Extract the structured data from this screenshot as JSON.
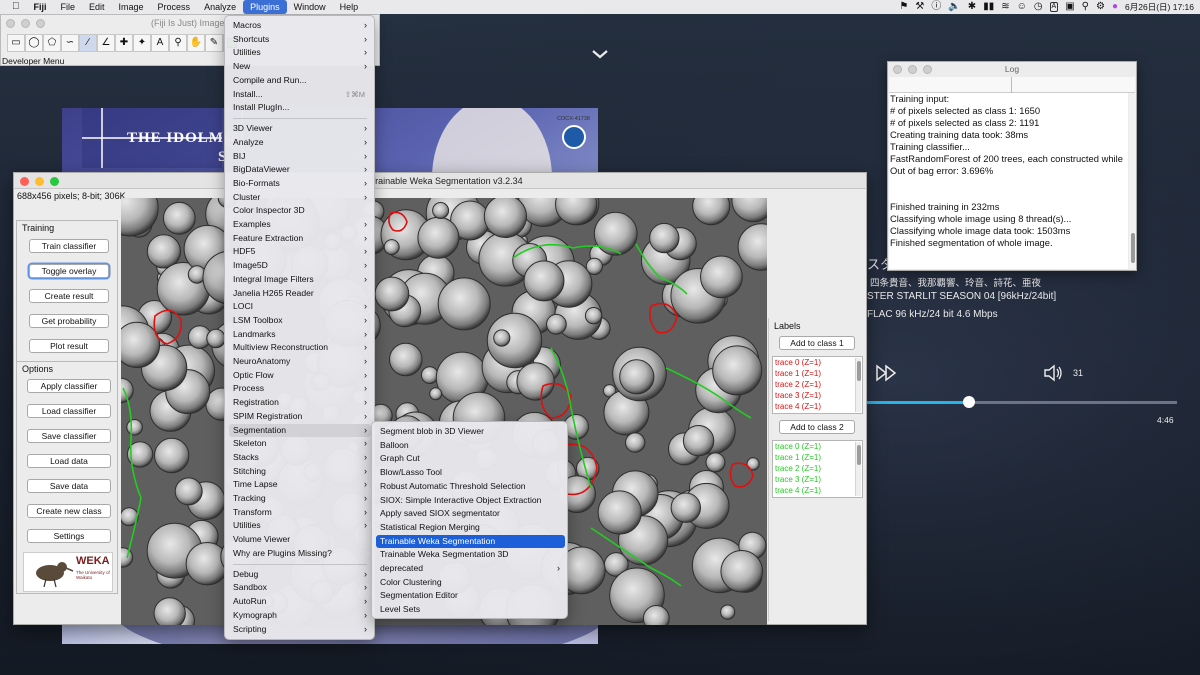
{
  "menubar": {
    "app_name": "Fiji",
    "items": [
      "File",
      "Edit",
      "Image",
      "Process",
      "Analyze",
      "Plugins",
      "Window",
      "Help"
    ],
    "active_item": "Plugins",
    "datetime": "6月26日(日)  17:16"
  },
  "fiji_window": {
    "title": "(Fiji Is Just) ImageJ",
    "tools": [
      "rectangle",
      "oval",
      "polygon",
      "freehand",
      "straight-line",
      "angle",
      "point",
      "wand",
      "text",
      "magnifier",
      "hand",
      "eyedropper",
      "color"
    ],
    "developer_menu": "Developer Menu"
  },
  "album": {
    "title_text": "THE IDOLM@",
    "subtitle_text": "S",
    "code": "COCX-41738"
  },
  "weka_window": {
    "title": "Trainable Weka Segmentation v3.2.34",
    "image_info": "688x456 pixels; 8-bit; 306K",
    "training": {
      "label": "Training",
      "buttons": [
        "Train classifier",
        "Toggle overlay",
        "Create result",
        "Get probability",
        "Plot result"
      ]
    },
    "options": {
      "label": "Options",
      "buttons": [
        "Apply classifier",
        "Load classifier",
        "Save classifier",
        "Load data",
        "Save data",
        "Create new class",
        "Settings"
      ]
    },
    "logo": {
      "title": "WEKA",
      "subtitle": "The University of Waikato"
    },
    "labels": {
      "title": "Labels",
      "class1_button": "Add to class 1",
      "class2_button": "Add to class 2",
      "class1_traces": [
        "trace 0 (Z=1)",
        "trace 1 (Z=1)",
        "trace 2 (Z=1)",
        "trace 3 (Z=1)",
        "trace 4 (Z=1)"
      ],
      "class2_traces": [
        "trace 0 (Z=1)",
        "trace 1 (Z=1)",
        "trace 2 (Z=1)",
        "trace 3 (Z=1)",
        "trace 4 (Z=1)"
      ],
      "class1_color": "#e01010",
      "class2_color": "#22cc22"
    }
  },
  "log_window": {
    "title": "Log",
    "lines": [
      "Training input:",
      "# of pixels selected as class 1: 1650",
      "# of pixels selected as class 2: 1191",
      "Creating training data took: 38ms",
      "Training classifier...",
      "FastRandomForest of 200 trees, each constructed while",
      "Out of bag error: 3.696%",
      "",
      "",
      "Finished training in 232ms",
      "Classifying whole image using 8 thread(s)...",
      "Classifying whole image data took: 1503ms",
      "Finished segmentation of whole image."
    ]
  },
  "music_player": {
    "title_fragment": "スタ",
    "artists": "四条貴音、我那覇響、玲音、詩花、亜夜",
    "album": "STER STARLIT SEASON 04 [96kHz/24bit]",
    "format": "FLAC 96 kHz/24 bit 4.6 Mbps",
    "volume": "31",
    "duration": "4:46",
    "progress": 0.33
  },
  "plugins_menu": {
    "groups": [
      [
        "Macros",
        "Shortcuts",
        "Utilities",
        "New",
        "Compile and Run...",
        "Install...",
        "Install PlugIn..."
      ],
      [
        "3D Viewer",
        "Analyze",
        "BIJ",
        "BigDataViewer",
        "Bio-Formats",
        "Cluster",
        "Color Inspector 3D",
        "Examples",
        "Feature Extraction",
        "HDF5",
        "Image5D",
        "Integral Image Filters",
        "Janelia H265 Reader",
        "LOCI",
        "LSM Toolbox",
        "Landmarks",
        "Multiview Reconstruction",
        "NeuroAnatomy",
        "Optic Flow",
        "Process",
        "Registration",
        "SPIM Registration",
        "Segmentation",
        "Skeleton",
        "Stacks",
        "Stitching",
        "Time Lapse",
        "Tracking",
        "Transform",
        "Utilities",
        "Volume Viewer",
        "Why are Plugins Missing?"
      ],
      [
        "Debug",
        "Sandbox",
        "AutoRun",
        "Kymograph",
        "Scripting"
      ]
    ],
    "submenu_items": [
      "Macros",
      "Shortcuts",
      "Utilities",
      "New",
      "3D Viewer",
      "Analyze",
      "BIJ",
      "BigDataViewer",
      "Bio-Formats",
      "Cluster",
      "Examples",
      "Feature Extraction",
      "HDF5",
      "Image5D",
      "Integral Image Filters",
      "LOCI",
      "LSM Toolbox",
      "Landmarks",
      "Multiview Reconstruction",
      "NeuroAnatomy",
      "Optic Flow",
      "Process",
      "Registration",
      "SPIM Registration",
      "Segmentation",
      "Skeleton",
      "Stacks",
      "Stitching",
      "Time Lapse",
      "Tracking",
      "Transform",
      "Utilities",
      "Debug",
      "Sandbox",
      "AutoRun",
      "Kymograph",
      "Scripting"
    ],
    "shortcut_install": "⇧⌘M",
    "highlighted": "Segmentation"
  },
  "segmentation_menu": {
    "items": [
      "Segment blob in 3D Viewer",
      "Balloon",
      "Graph Cut",
      "Blow/Lasso Tool",
      "Robust Automatic Threshold Selection",
      "SIOX: Simple Interactive Object Extraction",
      "Apply saved SIOX segmentator",
      "Statistical Region Merging",
      "Trainable Weka Segmentation",
      "Trainable Weka Segmentation 3D",
      "deprecated",
      "Color Clustering",
      "Segmentation Editor",
      "Level Sets"
    ],
    "selected": "Trainable Weka Segmentation",
    "submenu": "deprecated"
  }
}
